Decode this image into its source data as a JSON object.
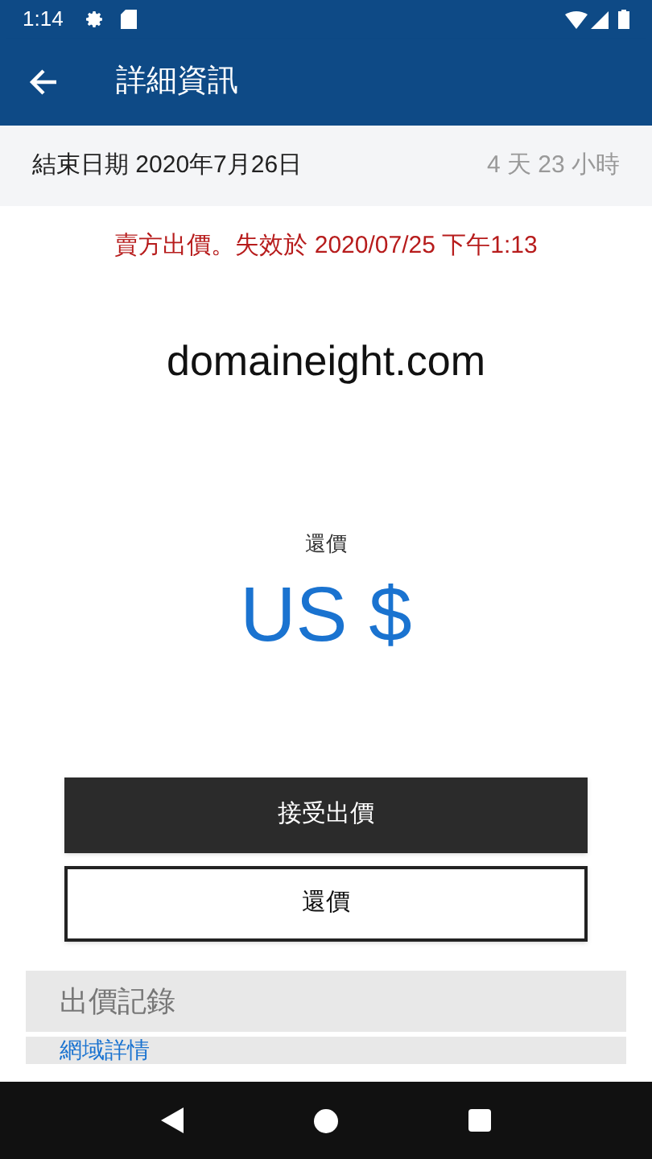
{
  "status_bar": {
    "time": "1:14"
  },
  "app_bar": {
    "title": "詳細資訊"
  },
  "end_date": {
    "label": "結束日期 2020年7月26日",
    "remaining": "4 天 23 小時"
  },
  "notice": "賣方出價。失效於 2020/07/25 下午1:13",
  "domain": "domaineight.com",
  "counter_offer": {
    "label": "還價",
    "amount": "US $"
  },
  "buttons": [
    {
      "label": "接受出價",
      "kind": "primary"
    },
    {
      "label": "還價",
      "kind": "outline"
    }
  ],
  "sections": [
    {
      "title": "出價記錄",
      "kind": "header"
    },
    {
      "title": "網域詳情",
      "kind": "link"
    }
  ]
}
